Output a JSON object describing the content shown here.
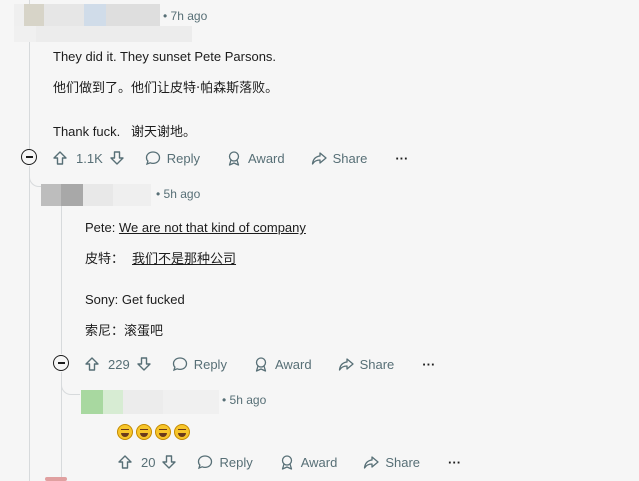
{
  "comments": [
    {
      "time": "7h ago",
      "lines": [
        "They did it. They sunset Pete Parsons.",
        "他们做到了。他们让皮特·帕森斯落败。",
        "Thank fuck.   谢天谢地。"
      ],
      "votes": "1.1K"
    },
    {
      "time": "5h ago",
      "pete_label": "Pete: ",
      "pete_quote": "We are not that kind of company",
      "pete_cn_label": "皮特：",
      "pete_cn_quote": "我们不是那种公司",
      "sony_line": "Sony: Get fucked",
      "sony_cn": "索尼：滚蛋吧",
      "votes": "229"
    },
    {
      "time": "5h ago",
      "emoji_name": "rolling-on-floor-laughing-emoji",
      "votes": "20"
    }
  ],
  "actions": {
    "reply": "Reply",
    "award": "Award",
    "share": "Share",
    "more": "···"
  },
  "colors": {
    "background": "#f6f6f6",
    "meta_text": "#576f76",
    "thread_line": "#d7dadc"
  },
  "icons": [
    "upvote-icon",
    "downvote-icon",
    "reply-bubble-icon",
    "award-icon",
    "share-arrow-icon",
    "more-icon",
    "collapse-icon"
  ]
}
